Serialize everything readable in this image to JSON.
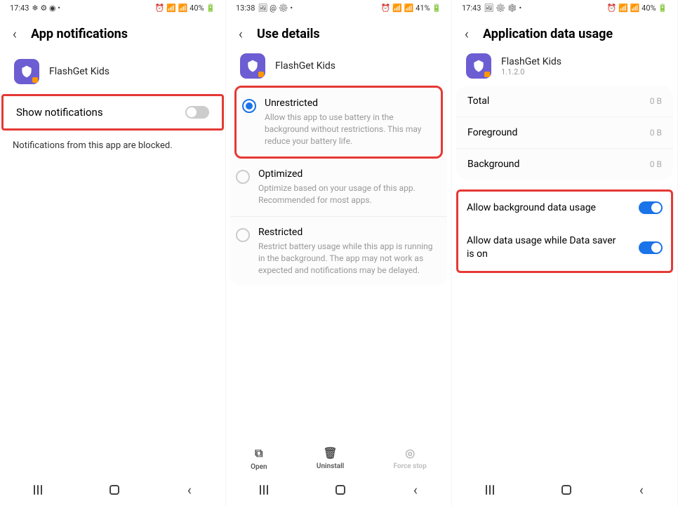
{
  "phone1": {
    "status": {
      "time": "17:43",
      "left_icons": "❄ ⚙ ◉ •",
      "right_icons": "⏰ 📶 📶 40% 🔋",
      "battery": "40%"
    },
    "header": {
      "title": "App notifications"
    },
    "app": {
      "name": "FlashGet Kids"
    },
    "show_notifications": {
      "label": "Show notifications"
    },
    "blocked_note": "Notifications from this app are blocked."
  },
  "phone2": {
    "status": {
      "time": "13:38",
      "left_icons": "🖼 @ ⚙ •",
      "right_icons": "⏰ 📶 📶 41% 🔋",
      "battery": "41%"
    },
    "header": {
      "title": "Use details"
    },
    "app": {
      "name": "FlashGet Kids"
    },
    "options": [
      {
        "title": "Unrestricted",
        "desc": "Allow this app to use battery in the background without restrictions. This may reduce your battery life."
      },
      {
        "title": "Optimized",
        "desc": "Optimize based on your usage of this app. Recommended for most apps."
      },
      {
        "title": "Restricted",
        "desc": "Restrict battery usage while this app is running in the background. The app may not work as expected and notifications may be delayed."
      }
    ],
    "actions": {
      "open": "Open",
      "uninstall": "Uninstall",
      "force": "Force stop"
    }
  },
  "phone3": {
    "status": {
      "time": "17:43",
      "left_icons": "🖼 ⚙ ❄ •",
      "right_icons": "⏰ 📶 📶 40% 🔋",
      "battery": "40%"
    },
    "header": {
      "title": "Application data usage"
    },
    "app": {
      "name": "FlashGet Kids",
      "version": "1.1.2.0"
    },
    "data": {
      "total_label": "Total",
      "total_value": "0 B",
      "fg_label": "Foreground",
      "fg_value": "0 B",
      "bg_label": "Background",
      "bg_value": "0 B"
    },
    "toggles": {
      "bg_data": "Allow background data usage",
      "data_saver": "Allow data usage while Data saver is on"
    }
  }
}
